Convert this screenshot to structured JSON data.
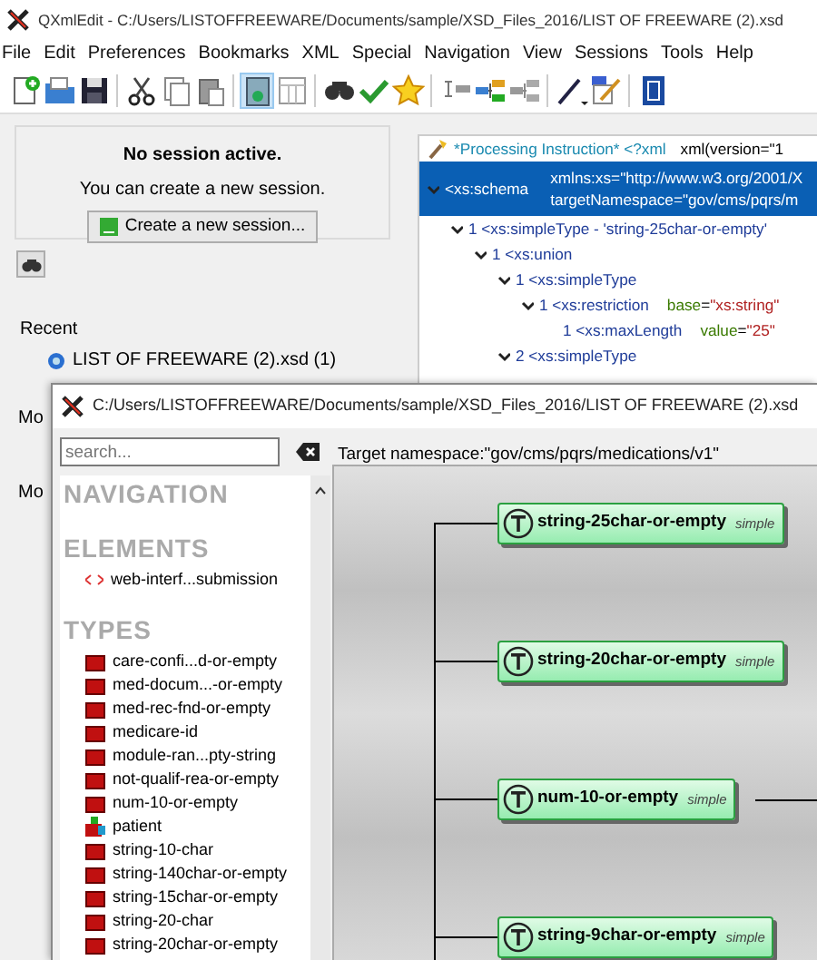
{
  "window": {
    "title": "QXmlEdit - C:/Users/LISTOFFREEWARE/Documents/sample/XSD_Files_2016/LIST OF FREEWARE (2).xsd"
  },
  "menu": [
    "File",
    "Edit",
    "Preferences",
    "Bookmarks",
    "XML",
    "Special",
    "Navigation",
    "View",
    "Sessions",
    "Tools",
    "Help"
  ],
  "toolbar": [
    [
      {
        "selected": false
      },
      {
        "selected": false
      },
      {
        "selected": false
      }
    ],
    [
      {
        "selected": false
      },
      {
        "selected": false
      },
      {
        "selected": false
      }
    ],
    [
      {
        "selected": true
      },
      {
        "selected": false
      }
    ],
    [
      {
        "selected": false
      },
      {
        "selected": false
      },
      {
        "selected": false
      }
    ],
    [
      {
        "selected": false
      },
      {
        "selected": false
      },
      {
        "selected": false
      }
    ],
    [
      {
        "selected": false
      },
      {
        "selected": false
      }
    ],
    [
      {
        "selected": false
      }
    ]
  ],
  "session": {
    "title": "No session active.",
    "text": "You can create a new session.",
    "button": "Create a new session..."
  },
  "recent": {
    "label": "Recent",
    "items": [
      "LIST OF FREEWARE (2).xsd (1)"
    ]
  },
  "more_labels": [
    "Mo",
    "Mo"
  ],
  "tree": [
    {
      "kind": "pi",
      "text": "*Processing Instruction* <?xml",
      "value": "xml(version=\"1",
      "selected": false
    },
    {
      "kind": "element",
      "tag": "<xs:schema",
      "selected": true,
      "expanded": true,
      "attributes": [
        {
          "name": "xmlns:xs",
          "separator": "=",
          "value": "\"http://www.w3.org/2001/X"
        },
        {
          "name": "targetNamespace",
          "separator": "=",
          "value": "\"gov/cms/pqrs/m"
        }
      ],
      "children": [
        {
          "kind": "element",
          "number": "1",
          "tag": "<xs:simpleType",
          "name": "-  'string-25char-or-empty'",
          "selected": false,
          "expanded": true,
          "children": [
            {
              "kind": "element",
              "number": "1",
              "tag": "<xs:union",
              "selected": false,
              "expanded": true,
              "children": [
                {
                  "kind": "element",
                  "number": "1",
                  "tag": "<xs:simpleType",
                  "selected": false,
                  "expanded": true,
                  "children": [
                    {
                      "kind": "element",
                      "number": "1",
                      "tag": "<xs:restriction",
                      "selected": false,
                      "expanded": true,
                      "attributes": [
                        {
                          "name": "base",
                          "separator": "=",
                          "value": "\"xs:string\""
                        }
                      ],
                      "children": [
                        {
                          "kind": "element",
                          "number": "1",
                          "tag": "<xs:maxLength",
                          "selected": false,
                          "attributes": [
                            {
                              "name": "value",
                              "separator": "=",
                              "value": "\"25\""
                            }
                          ]
                        }
                      ]
                    }
                  ]
                },
                {
                  "kind": "element",
                  "number": "2",
                  "tag": "<xs:simpleType",
                  "selected": false,
                  "expanded": true
                }
              ]
            }
          ]
        }
      ]
    }
  ],
  "child_window": {
    "title": "C:/Users/LISTOFFREEWARE/Documents/sample/XSD_Files_2016/LIST OF FREEWARE (2).xsd",
    "search": {
      "placeholder": "search..."
    },
    "navigation": [
      {
        "heading": "NAVIGATION"
      },
      {
        "heading": "ELEMENTS",
        "items": [
          {
            "kind": "element",
            "label": "web-interf...submission"
          }
        ]
      },
      {
        "heading": "TYPES",
        "items": [
          {
            "kind": "simple",
            "label": "care-confi...d-or-empty"
          },
          {
            "kind": "simple",
            "label": "med-docum...-or-empty"
          },
          {
            "kind": "simple",
            "label": "med-rec-fnd-or-empty"
          },
          {
            "kind": "simple",
            "label": "medicare-id"
          },
          {
            "kind": "simple",
            "label": "module-ran...pty-string"
          },
          {
            "kind": "simple",
            "label": "not-qualif-rea-or-empty"
          },
          {
            "kind": "simple",
            "label": "num-10-or-empty"
          },
          {
            "kind": "complex",
            "label": "patient"
          },
          {
            "kind": "simple",
            "label": "string-10-char"
          },
          {
            "kind": "simple",
            "label": "string-140char-or-empty"
          },
          {
            "kind": "simple",
            "label": "string-15char-or-empty"
          },
          {
            "kind": "simple",
            "label": "string-20-char"
          },
          {
            "kind": "simple",
            "label": "string-20char-or-empty"
          }
        ]
      }
    ],
    "target_namespace": "Target namespace:\"gov/cms/pqrs/medications/v1\"",
    "diagram": [
      {
        "name": "string-25char-or-empty",
        "type": "simple",
        "expanded": false
      },
      {
        "name": "string-20char-or-empty",
        "type": "simple",
        "expanded": false
      },
      {
        "name": "num-10-or-empty",
        "type": "simple",
        "expanded": true
      },
      {
        "name": "string-9char-or-empty",
        "type": "simple",
        "expanded": false
      }
    ]
  }
}
